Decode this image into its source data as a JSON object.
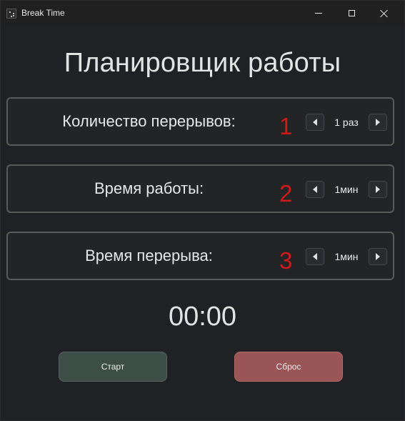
{
  "window": {
    "title": "Break Time",
    "icon": "app-icon",
    "controls": [
      "minimize-icon",
      "maximize-icon",
      "close-icon"
    ]
  },
  "main": {
    "heading": "Планировщик работы",
    "settings": [
      {
        "label": "Количество перерывов:",
        "number": "1",
        "value": "1 раз"
      },
      {
        "label": "Время работы:",
        "number": "2",
        "value": "1мин"
      },
      {
        "label": "Время перерыва:",
        "number": "3",
        "value": "1мин"
      }
    ],
    "timer": "00:00",
    "buttons": {
      "start": "Старт",
      "reset": "Сброс"
    }
  },
  "colors": {
    "background": "#202124",
    "number_accent": "#d01a1a",
    "start_button": "#3d4e46",
    "reset_button": "#9a5656"
  }
}
